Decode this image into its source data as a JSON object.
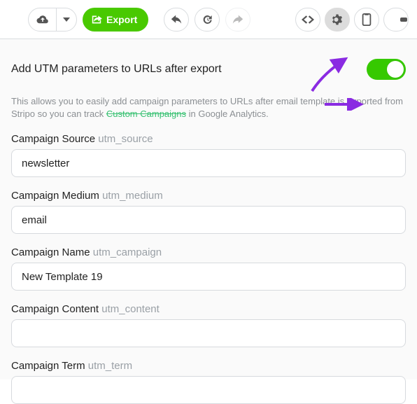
{
  "toolbar": {
    "export_label": "Export"
  },
  "panel": {
    "title": "Add UTM parameters to URLs after export",
    "toggle_on": true,
    "help_pre": "This allows you to easily add campaign parameters to URLs after email template is exported from Stripo so you can track ",
    "help_link": "Custom Campaigns",
    "help_post": " in Google Analytics."
  },
  "fields": {
    "source": {
      "label": "Campaign Source",
      "hint": "utm_source",
      "value": "newsletter"
    },
    "medium": {
      "label": "Campaign Medium",
      "hint": "utm_medium",
      "value": "email"
    },
    "name": {
      "label": "Campaign Name",
      "hint": "utm_campaign",
      "value": "New Template 19"
    },
    "content": {
      "label": "Campaign Content",
      "hint": "utm_content",
      "value": ""
    },
    "term": {
      "label": "Campaign Term",
      "hint": "utm_term",
      "value": ""
    }
  }
}
